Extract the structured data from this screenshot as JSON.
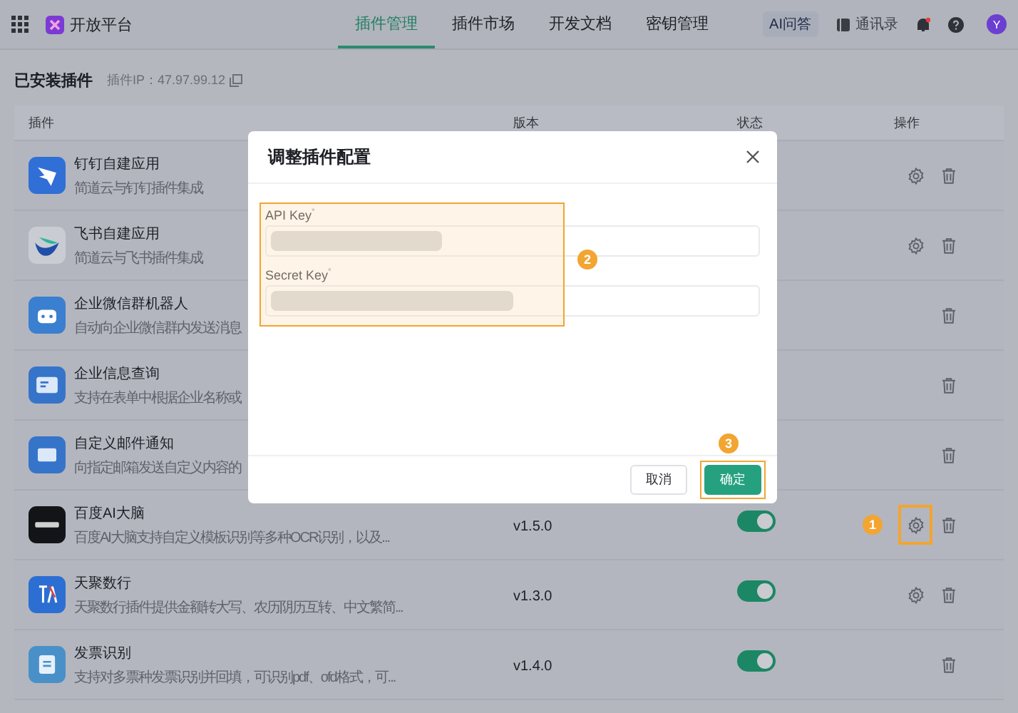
{
  "header": {
    "app_title": "开放平台",
    "tabs": [
      {
        "label": "插件管理",
        "selected": true
      },
      {
        "label": "插件市场",
        "selected": false
      },
      {
        "label": "开发文档",
        "selected": false
      },
      {
        "label": "密钥管理",
        "selected": false
      }
    ],
    "ai_button": "AI问答",
    "contacts": "通讯录",
    "avatar": "Y"
  },
  "section": {
    "title": "已安装插件",
    "ip_label": "插件IP：47.97.99.12"
  },
  "table": {
    "columns": [
      "插件",
      "版本",
      "状态",
      "操作"
    ],
    "rows": [
      {
        "name": "钉钉自建应用",
        "description": "简道云与钉钉插件集成",
        "configurable": true,
        "highlighted": false
      },
      {
        "name": "飞书自建应用",
        "description": "简道云与飞书插件集成",
        "configurable": true,
        "highlighted": false
      },
      {
        "name": "企业微信群机器人",
        "description": "自动向企业微信群内发送消息",
        "configurable": false,
        "highlighted": false
      },
      {
        "name": "企业信息查询",
        "description": "支持在表单中根据企业名称或",
        "configurable": false,
        "highlighted": false
      },
      {
        "name": "自定义邮件通知",
        "description": "向指定邮箱发送自定义内容的",
        "configurable": false,
        "highlighted": false
      },
      {
        "name": "百度AI大脑",
        "description": "百度AI大脑支持自定义模板识别等多种OCR识别，以及...",
        "version": "v1.5.0",
        "on": true,
        "configurable": true,
        "highlighted": true,
        "badge": "1"
      },
      {
        "name": "天聚数行",
        "description": "天聚数行插件提供金额转大写、农历阴历互转、中文繁简...",
        "version": "v1.3.0",
        "on": true,
        "configurable": true,
        "highlighted": false
      },
      {
        "name": "发票识别",
        "description": "支持对多票种发票识别并回填，可识别pdf、ofd格式，可...",
        "version": "v1.4.0",
        "on": true,
        "configurable": false,
        "highlighted": false
      }
    ]
  },
  "dialog": {
    "title": "调整插件配置",
    "fields": [
      {
        "label": "API Key$^{*}$"
      },
      {
        "label": "Secret Key$^{*}$"
      }
    ],
    "callout_badge": "2",
    "buttons": [
      {
        "label": "取消",
        "kind": "secondary",
        "highlighted": false
      },
      {
        "label": "确定",
        "kind": "primary",
        "highlighted": true,
        "badge": "3"
      }
    ]
  }
}
